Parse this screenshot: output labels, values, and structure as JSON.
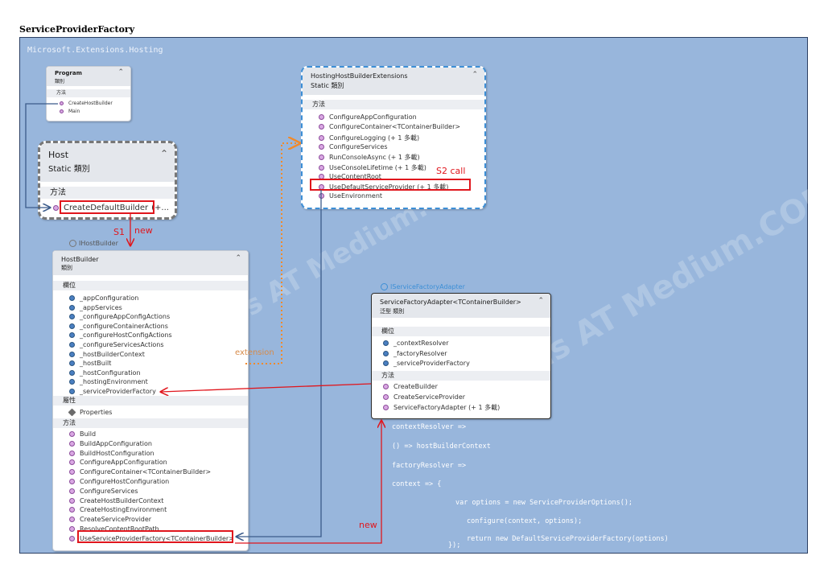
{
  "title": "ServiceProviderFactory",
  "namespace": "Microsoft.Extensions.Hosting",
  "watermark": "zxdas AT Medium.COM",
  "program": {
    "name": "Program",
    "kind": "類別",
    "section": "方法",
    "methods": [
      "CreateHostBuilder",
      "Main"
    ]
  },
  "host": {
    "name": "Host",
    "kind": "Static 類別",
    "section": "方法",
    "method": "CreateDefaultBuilder",
    "method_suffix": "(+..."
  },
  "hosting_ext": {
    "name": "HostingHostBuilderExtensions",
    "kind": "Static 類別",
    "section": "方法",
    "methods": [
      "ConfigureAppConfiguration",
      "ConfigureContainer<TContainerBuilder>",
      "ConfigureLogging (+ 1 多載)",
      "ConfigureServices",
      "RunConsoleAsync (+ 1 多載)",
      "UseConsoleLifetime (+ 1 多載)",
      "UseContentRoot",
      "UseDefaultServiceProvider (+ 1 多載)",
      "UseEnvironment"
    ]
  },
  "host_builder": {
    "interface": "IHostBuilder",
    "name": "HostBuilder",
    "kind": "類別",
    "fields_section": "欄位",
    "fields": [
      "_appConfiguration",
      "_appServices",
      "_configureAppConfigActions",
      "_configureContainerActions",
      "_configureHostConfigActions",
      "_configureServicesActions",
      "_hostBuilderContext",
      "_hostBuilt",
      "_hostConfiguration",
      "_hostingEnvironment",
      "_serviceProviderFactory"
    ],
    "props_section": "屬性",
    "props": [
      "Properties"
    ],
    "methods_section": "方法",
    "methods": [
      "Build",
      "BuildAppConfiguration",
      "BuildHostConfiguration",
      "ConfigureAppConfiguration",
      "ConfigureContainer<TContainerBuilder>",
      "ConfigureHostConfiguration",
      "ConfigureServices",
      "CreateHostBuilderContext",
      "CreateHostingEnvironment",
      "CreateServiceProvider",
      "ResolveContentRootPath",
      "UseServiceProviderFactory<TContainerBuilder>"
    ]
  },
  "adapter": {
    "interface": "IServiceFactoryAdapter",
    "name": "ServiceFactoryAdapter<TContainerBuilder>",
    "kind": "泛型 類別",
    "fields_section": "欄位",
    "fields": [
      "_contextResolver",
      "_factoryResolver",
      "_serviceProviderFactory"
    ],
    "methods_section": "方法",
    "methods": [
      "CreateBuilder",
      "CreateServiceProvider",
      "ServiceFactoryAdapter (+ 1 多載)"
    ]
  },
  "labels": {
    "s1": "S1",
    "new_top": "new",
    "s2": "S2 call",
    "extension": "extension",
    "new_bottom": "new"
  },
  "code_lines": [
    "contextResolver =>",
    "() =>  hostBuilderContext",
    "factoryResolver =>",
    "context => {",
    "var options = new ServiceProviderOptions();",
    "configure(context, options);",
    "return new DefaultServiceProviderFactory(options)",
    "});"
  ],
  "colors": {
    "canvas": "#98b6dc",
    "frame_border": "#2b3f63",
    "highlight": "#e0161d",
    "extension_arrow": "#f08a2c",
    "link_line": "#3b5b8a"
  }
}
